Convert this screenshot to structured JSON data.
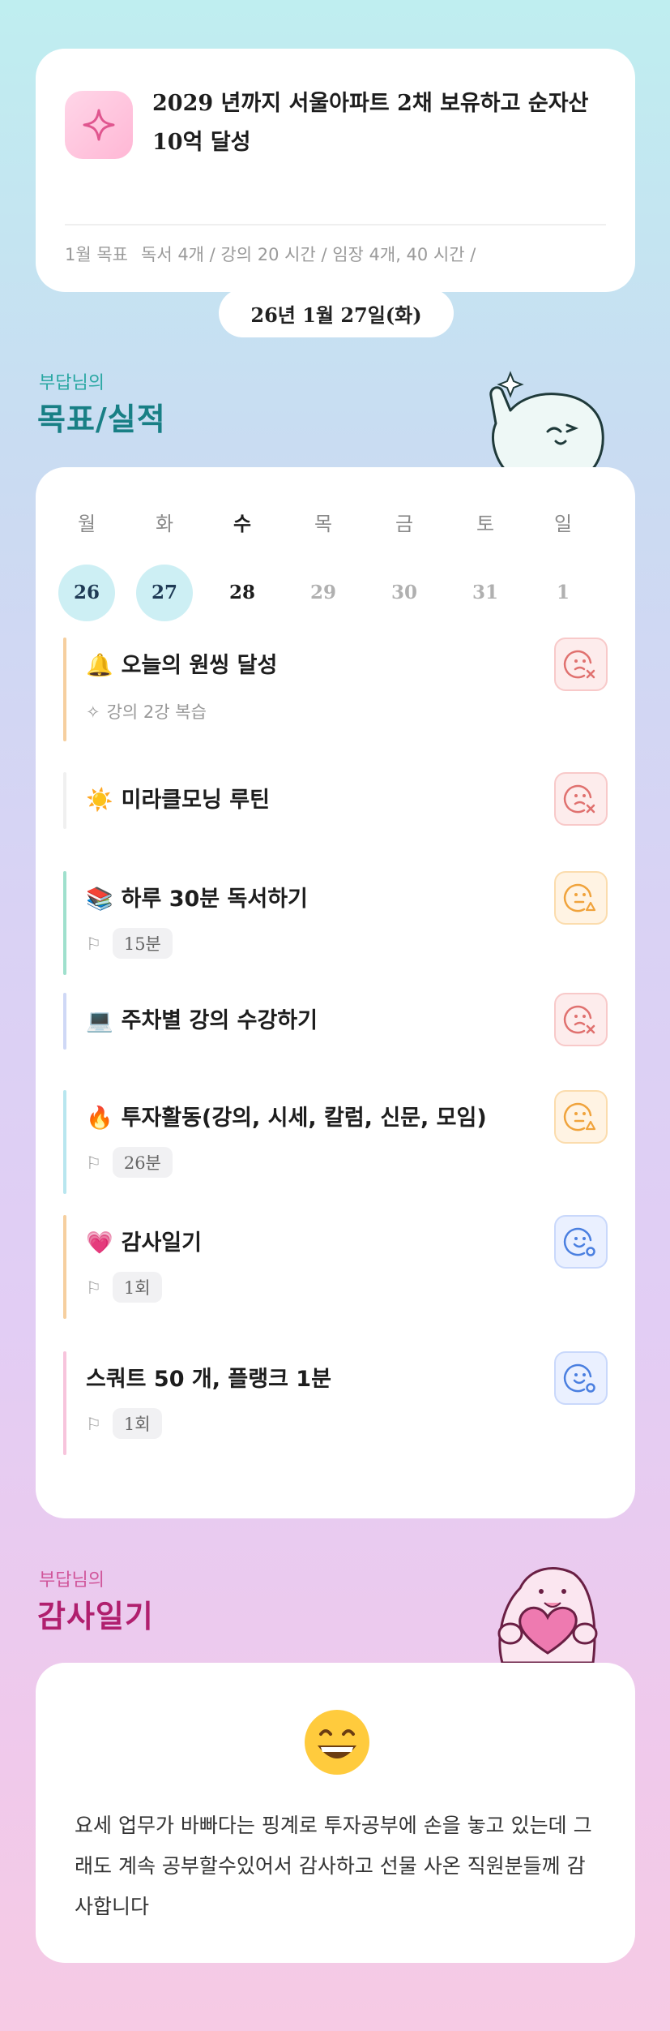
{
  "goal": {
    "title": "2029 년까지 서울아파트 2채 보유하고 순자산 10억 달성",
    "month_label": "1월 목표",
    "month_goals": "독서 4개 / 강의 20 시간 / 임장 4개, 40 시간 /"
  },
  "date": "26년 1월 27일(화)",
  "goals_section": {
    "owner": "부답님의",
    "title": "목표/실적"
  },
  "week": [
    {
      "wd": "월",
      "dn": "26",
      "state": "past"
    },
    {
      "wd": "화",
      "dn": "27",
      "state": "past"
    },
    {
      "wd": "수",
      "dn": "28",
      "state": "today"
    },
    {
      "wd": "목",
      "dn": "29",
      "state": "future"
    },
    {
      "wd": "금",
      "dn": "30",
      "state": "future"
    },
    {
      "wd": "토",
      "dn": "31",
      "state": "future"
    },
    {
      "wd": "일",
      "dn": "1",
      "state": "future"
    }
  ],
  "items": [
    {
      "emoji": "🔔",
      "title": "오늘의 원씽 달성",
      "sub": "강의 2강 복습",
      "status": "fail",
      "bar": "#f6cf9f"
    },
    {
      "emoji": "☀️",
      "title": "미라클모닝 루틴",
      "sub": "",
      "status": "fail",
      "bar": "#f0f0f0"
    },
    {
      "emoji": "📚",
      "title": "하루 30분 독서하기",
      "badge": "15분",
      "status": "partial",
      "bar": "#9fe0cd"
    },
    {
      "emoji": "💻",
      "title": "주차별 강의 수강하기",
      "sub": "",
      "status": "fail",
      "bar": "#cfd8f6"
    },
    {
      "emoji": "🔥",
      "title": "투자활동(강의, 시세, 칼럼, 신문, 모임)",
      "badge": "26분",
      "status": "partial",
      "bar": "#b8e6ef"
    },
    {
      "emoji": "💗",
      "title": "감사일기",
      "badge": "1회",
      "status": "done",
      "bar": "#f6cf9f"
    },
    {
      "emoji": "",
      "title": "스쿼트 50 개, 플랭크 1분",
      "badge": "1회",
      "status": "done",
      "bar": "#f7c4dc"
    }
  ],
  "diary_section": {
    "owner": "부답님의",
    "title": "감사일기"
  },
  "diary": {
    "emoji": "😄",
    "text": "요세 업무가 바빠다는 핑계로 투자공부에 손을 놓고 있는데 그래도 계속 공부할수있어서 감사하고 선물 사온 직원분들께 감사합니다"
  },
  "colors": {
    "accent": "#187f85",
    "fail": "#e0716f",
    "partial": "#f0a33c",
    "done": "#4a7fe0"
  }
}
